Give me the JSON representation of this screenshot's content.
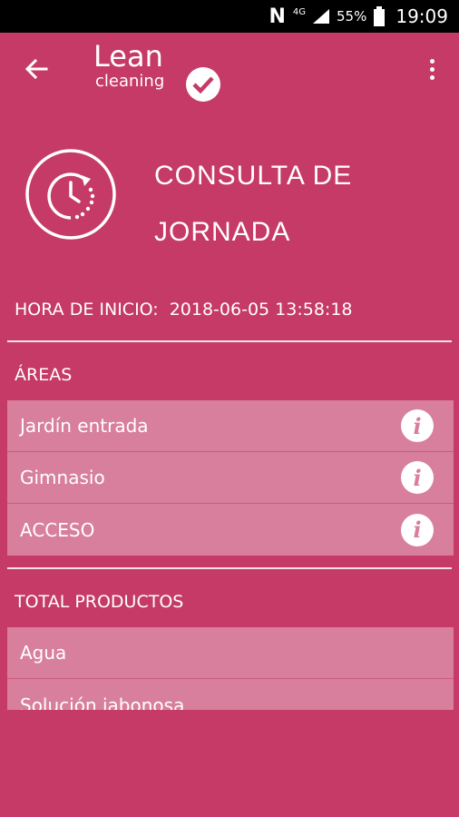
{
  "status_bar": {
    "network_letter": "N",
    "network_type": "4G",
    "battery_percent": "55%",
    "time": "19:09"
  },
  "app_bar": {
    "logo_title": "Lean",
    "logo_subtitle": "cleaning",
    "back_icon": "arrow-back-icon",
    "menu_icon": "more-vert-icon"
  },
  "page": {
    "title": "CONSULTA DE JORNADA",
    "icon": "clock-history-icon"
  },
  "start": {
    "label": "HORA DE INICIO:",
    "value": "2018-06-05 13:58:18"
  },
  "areas": {
    "label": "ÁREAS",
    "items": [
      {
        "name": "Jardín entrada"
      },
      {
        "name": "Gimnasio"
      },
      {
        "name": "ACCESO"
      }
    ],
    "info_glyph": "i"
  },
  "products": {
    "label": "TOTAL PRODUCTOS",
    "items": [
      {
        "name": "Agua"
      },
      {
        "name": "Solución jabonosa"
      }
    ]
  },
  "colors": {
    "background": "#c53a66",
    "list_background": "#d77f9c",
    "status_bar": "#000000"
  }
}
